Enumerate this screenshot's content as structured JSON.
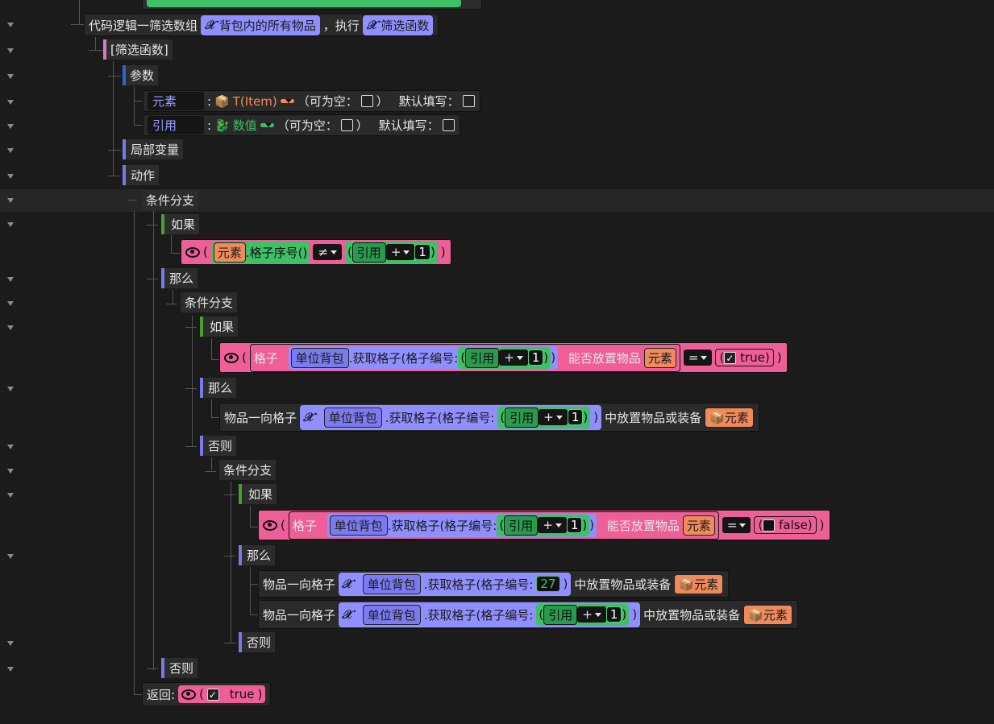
{
  "top_block": {
    "label": "代码逻辑一筛选数组",
    "list": "背包内的所有物品",
    "mid": "，执行",
    "func": "筛选函数"
  },
  "func_node": "[筛选函数]",
  "params": "参数",
  "param1": {
    "name": "元素",
    "colon": ":",
    "type": "T(Item)",
    "nullable": "（可为空：",
    "close": "）",
    "default": "默认填写："
  },
  "param2": {
    "name": "引用",
    "colon": ":",
    "type": "数值",
    "nullable": "（可为空：",
    "close": "）",
    "default": "默认填写："
  },
  "locals": "局部变量",
  "actions": "动作",
  "branch1": {
    "label": "条件分支",
    "if": "如果",
    "then": "那么",
    "else": "否则"
  },
  "cond1": {
    "elem": "元素",
    "method": ".格子序号()",
    "op": "≠",
    "ref": "引用",
    "plus": "+",
    "one": "1"
  },
  "branch2": {
    "label": "条件分支",
    "if": "如果",
    "then": "那么",
    "else": "否则"
  },
  "cond2": {
    "grid": "格子",
    "bag": "单位背包",
    "get": ".获取格子(格子编号:",
    "ref": "引用",
    "plus": "+",
    "one": "1",
    "can": "能否放置物品",
    "elem": "元素",
    "eq": "=",
    "bool": "true"
  },
  "put1": {
    "label": "物品一向格子",
    "bag": "单位背包",
    "get": ".获取格子(格子编号:",
    "ref": "引用",
    "plus": "+",
    "one": "1",
    "tail": "中放置物品或装备",
    "elem": "元素"
  },
  "branch3": {
    "label": "条件分支",
    "if": "如果",
    "then": "那么",
    "else": "否则"
  },
  "cond3": {
    "grid": "格子",
    "bag": "单位背包",
    "get": ".获取格子(格子编号:",
    "ref": "引用",
    "plus": "+",
    "one": "1",
    "can": "能否放置物品",
    "elem": "元素",
    "eq": "=",
    "bool": "false"
  },
  "put2": {
    "label": "物品一向格子",
    "bag": "单位背包",
    "get": ".获取格子(格子编号:",
    "num": "27",
    "tail": "中放置物品或装备",
    "elem": "元素"
  },
  "put3": {
    "label": "物品一向格子",
    "bag": "单位背包",
    "get": ".获取格子(格子编号:",
    "ref": "引用",
    "plus": "+",
    "one": "1",
    "tail": "中放置物品或装备",
    "elem": "元素"
  },
  "ret": {
    "label": "返回:",
    "bool": "true"
  },
  "colors": {
    "green": "#3fbf66",
    "purple": "#8f8fff",
    "orange": "#f08a5a",
    "pink": "#ef5f97"
  }
}
